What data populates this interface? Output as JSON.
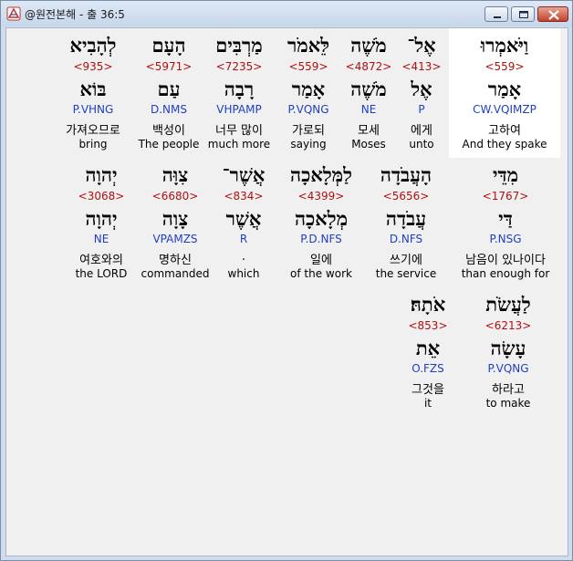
{
  "window": {
    "title": "@원전본해 - 출 36:5",
    "icon": "app-icon"
  },
  "rows": [
    {
      "words": [
        {
          "heb": "וַיֹּאמְרוּ",
          "strong": "<559>",
          "lemma": "אָמַר",
          "morph": "CW.VQIMZP",
          "kor": "고하여",
          "eng": "And they spake",
          "highlight": true
        },
        {
          "heb": "אֶל־",
          "strong": "<413>",
          "lemma": "אֶל",
          "morph": "P",
          "kor": "에게",
          "eng": "unto"
        },
        {
          "heb": "מֹשֶׁה",
          "strong": "<4872>",
          "lemma": "מֹשֶׁה",
          "morph": "NE",
          "kor": "모세",
          "eng": "Moses"
        },
        {
          "heb": "לֵּאמֹר",
          "strong": "<559>",
          "lemma": "אָמַר",
          "morph": "P.VQNG",
          "kor": "가로되",
          "eng": "saying"
        },
        {
          "heb": "מַרְבִּים",
          "strong": "<7235>",
          "lemma": "רָבָה",
          "morph": "VHPAMP",
          "kor": "너무 많이",
          "eng": "much more"
        },
        {
          "heb": "הָעָם",
          "strong": "<5971>",
          "lemma": "עַם",
          "morph": "D.NMS",
          "kor": "백성이",
          "eng": "The people"
        },
        {
          "heb": "לְהָבִיא",
          "strong": "<935>",
          "lemma": "בּוֹא",
          "morph": "P.VHNG",
          "kor": "가져오므로",
          "eng": "bring"
        }
      ]
    },
    {
      "words": [
        {
          "heb": "מִדֵּי",
          "strong": "<1767>",
          "lemma": "דַּי",
          "morph": "P.NSG",
          "kor": "남음이 있나이다",
          "eng": "than enough for"
        },
        {
          "heb": "הָעֲבֹדָה",
          "strong": "<5656>",
          "lemma": "עֲבֹדָה",
          "morph": "D.NFS",
          "kor": "쓰기에",
          "eng": "the service"
        },
        {
          "heb": "לַמְּלָאכָה",
          "strong": "<4399>",
          "lemma": "מְלָאכָה",
          "morph": "P.D.NFS",
          "kor": "일에",
          "eng": "of the work"
        },
        {
          "heb": "אֲשֶׁר־",
          "strong": "<834>",
          "lemma": "אֲשֶׁר",
          "morph": "R",
          "kor": ".",
          "eng": "which"
        },
        {
          "heb": "צִוָּה",
          "strong": "<6680>",
          "lemma": "צָוָה",
          "morph": "VPAMZS",
          "kor": "명하신",
          "eng": "commanded"
        },
        {
          "heb": "יְהוָה",
          "strong": "<3068>",
          "lemma": "יְהוָה",
          "morph": "NE",
          "kor": "여호와의",
          "eng": "the LORD"
        }
      ]
    },
    {
      "words": [
        {
          "heb": "לַעֲשֹׂת",
          "strong": "<6213>",
          "lemma": "עָשָׂה",
          "morph": "P.VQNG",
          "kor": "하라고",
          "eng": "to make"
        },
        {
          "heb": "אֹתָהּ׃",
          "strong": "<853>",
          "lemma": "אֵת",
          "morph": "O.FZS",
          "kor": "그것을",
          "eng": "it"
        }
      ]
    }
  ]
}
